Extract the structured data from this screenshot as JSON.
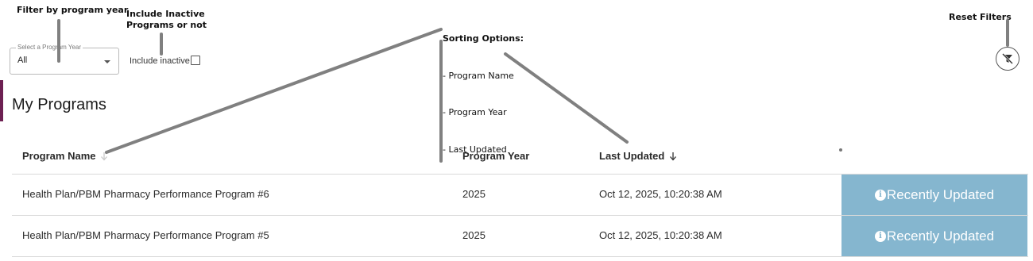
{
  "annotations": {
    "filter_year": "Filter by program year",
    "include_inactive_line1": "Include Inactive",
    "include_inactive_line2": "Programs or not",
    "sorting_title": "Sorting Options:",
    "sorting_opt1": "- Program Name",
    "sorting_opt2": "- Program Year",
    "sorting_opt3": "- Last Updated",
    "reset_filters": "Reset Filters"
  },
  "filters": {
    "program_year_label": "Select a Program Year",
    "program_year_value": "All",
    "include_inactive_label": "Include inactive",
    "include_inactive_checked": false
  },
  "section": {
    "title": "My Programs",
    "accent_color": "#6d2052"
  },
  "table": {
    "columns": {
      "name": "Program Name",
      "year": "Program Year",
      "updated": "Last Updated"
    },
    "rows": [
      {
        "name": "Health Plan/PBM Pharmacy Performance Program #6",
        "year": "2025",
        "updated": "Oct 12, 2025, 10:20:38 AM",
        "status": "Recently Updated"
      },
      {
        "name": "Health Plan/PBM Pharmacy Performance Program #5",
        "year": "2025",
        "updated": "Oct 12, 2025, 10:20:38 AM",
        "status": "Recently Updated"
      }
    ],
    "status_color": "#85b6cf"
  },
  "icons": {
    "reset": "filter-off-icon",
    "status": "info-icon",
    "sort": "arrow-down-icon"
  }
}
